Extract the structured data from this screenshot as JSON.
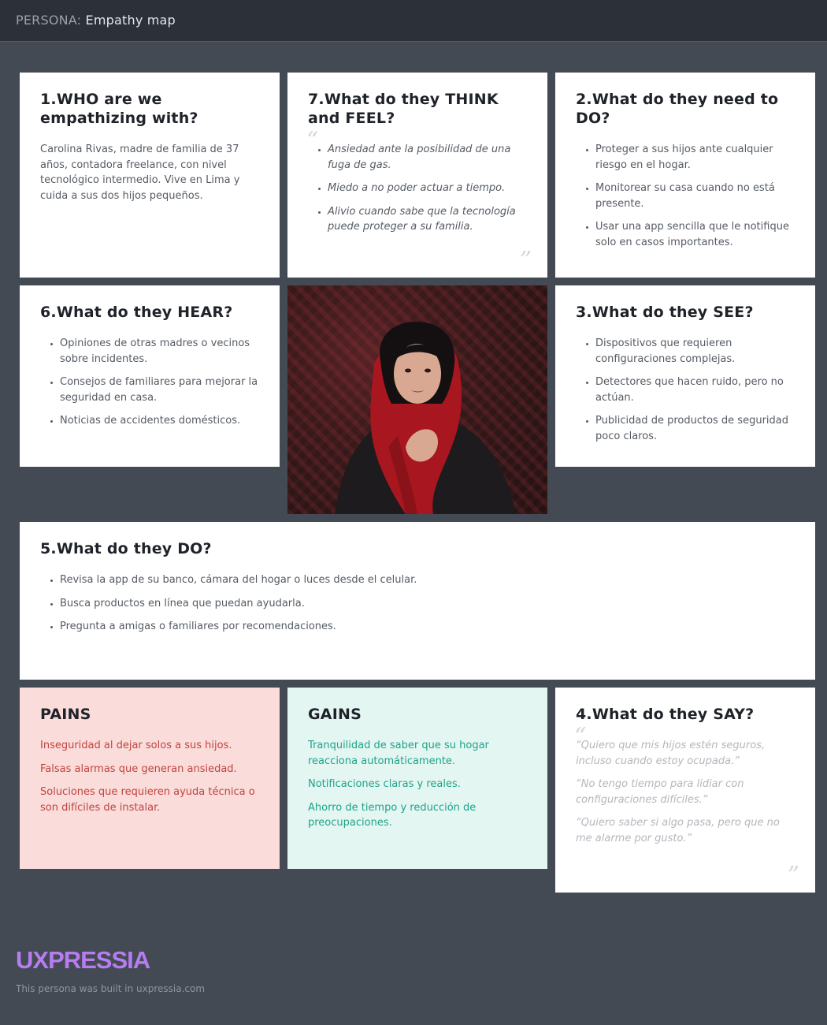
{
  "header": {
    "prefix": "PERSONA:",
    "title": "Empathy map"
  },
  "who": {
    "title": "1.WHO are we empathizing with?",
    "body": "Carolina Rivas, madre de familia de 37 años, contadora freelance, con nivel tecnológico intermedio. Vive en Lima y cuida a sus dos hijos pequeños."
  },
  "think_feel": {
    "title": "7.What do they THINK and FEEL?",
    "items": [
      "Ansiedad ante la posibilidad de una fuga de gas.",
      "Miedo a no poder actuar a tiempo.",
      "Alivio cuando sabe que la tecnología puede proteger a su familia."
    ]
  },
  "need_do": {
    "title": "2.What do they need to DO?",
    "items": [
      "Proteger a sus hijos ante cualquier riesgo en el hogar.",
      "Monitorear su casa cuando no está presente.",
      "Usar una app sencilla que le notifique solo en casos importantes."
    ]
  },
  "hear": {
    "title": "6.What do they HEAR?",
    "items": [
      "Opiniones de otras madres o vecinos sobre incidentes.",
      "Consejos de familiares para mejorar la seguridad en casa.",
      "Noticias de accidentes domésticos."
    ]
  },
  "see": {
    "title": "3.What do they SEE?",
    "items": [
      "Dispositivos que requieren configuraciones complejas.",
      "Detectores que hacen ruido, pero no actúan.",
      "Publicidad de productos de seguridad poco claros."
    ]
  },
  "do": {
    "title": "5.What do they DO?",
    "items": [
      "Revisa la app de su banco, cámara del hogar o luces desde el celular.",
      "Busca productos en línea que puedan ayudarla.",
      "Pregunta a amigas o familiares por recomendaciones."
    ]
  },
  "pains": {
    "title": "PAINS",
    "items": [
      "Inseguridad al dejar solos a sus hijos.",
      "Falsas alarmas que generan ansiedad.",
      "Soluciones que requieren ayuda técnica o son difíciles de instalar."
    ]
  },
  "gains": {
    "title": "GAINS",
    "items": [
      "Tranquilidad de saber que su hogar reacciona automáticamente.",
      "Notificaciones claras y reales.",
      "Ahorro de tiempo y reducción de preocupaciones."
    ]
  },
  "say": {
    "title": "4.What do they SAY?",
    "items": [
      "“Quiero que mis hijos estén seguros, incluso cuando estoy ocupada.”",
      "“No tengo tiempo para lidiar con configuraciones difíciles.”",
      "“Quiero saber si algo pasa, pero que no me alarme por gusto.”"
    ]
  },
  "footer": {
    "logo": "UXPRESSIA",
    "note": "This persona was built in uxpressia.com"
  },
  "colors": {
    "background": "#434a54",
    "header": "#2b3039",
    "pains_bg": "#fadcda",
    "pains_text": "#c0443f",
    "gains_bg": "#e3f6f2",
    "gains_text": "#1fa389",
    "logo": "#b77cf0"
  }
}
